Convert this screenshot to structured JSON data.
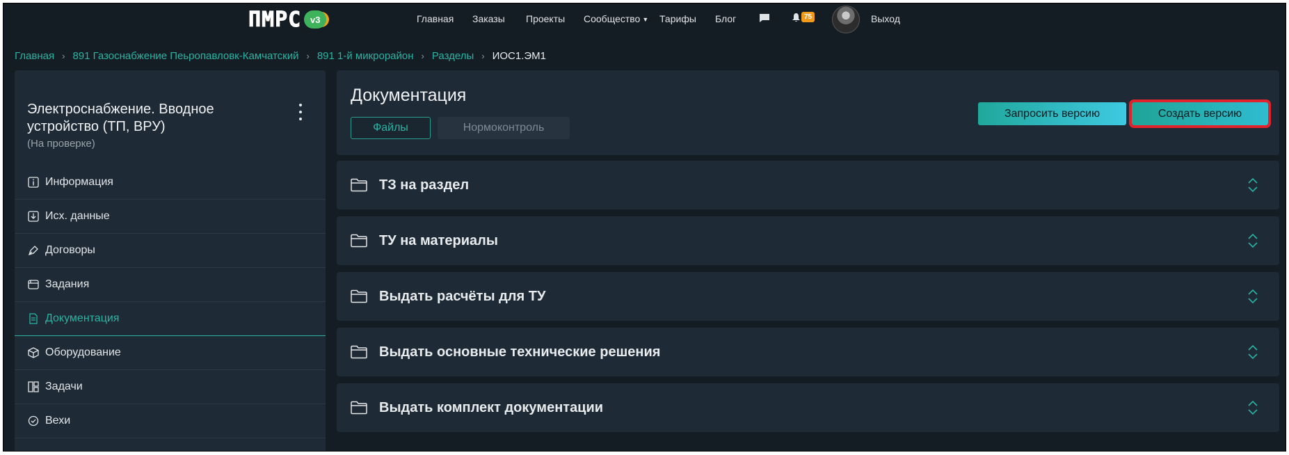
{
  "nav": {
    "logo_text": "ПМРС",
    "logo_badge": "v3",
    "items": [
      {
        "label": "Главная"
      },
      {
        "label": "Заказы"
      },
      {
        "label": "Проекты"
      },
      {
        "label": "Сообщество",
        "has_dropdown": true
      },
      {
        "label": "Тарифы"
      },
      {
        "label": "Блог"
      }
    ],
    "notifications_count": "75",
    "logout": "Выход",
    "icons": [
      "chat-icon",
      "bell-icon",
      "avatar"
    ]
  },
  "breadcrumb": [
    {
      "label": "Главная"
    },
    {
      "label": "891 Газоснабжение Пеьропавловк-Камчатский"
    },
    {
      "label": "891 1-й микрорайон"
    },
    {
      "label": "Разделы"
    },
    {
      "label": "ИОС1.ЭМ1",
      "current": true
    }
  ],
  "sidebar": {
    "title": "Электроснабжение. Вводное устройство (ТП, ВРУ)",
    "status": "(На проверке)",
    "items": [
      {
        "label": "Информация",
        "icon": "info-icon"
      },
      {
        "label": "Исх. данные",
        "icon": "download-icon"
      },
      {
        "label": "Договоры",
        "icon": "pen-icon"
      },
      {
        "label": "Задания",
        "icon": "window-icon"
      },
      {
        "label": "Документация",
        "icon": "document-icon",
        "active": true
      },
      {
        "label": "Оборудование",
        "icon": "box-icon"
      },
      {
        "label": "Задачи",
        "icon": "board-icon"
      },
      {
        "label": "Вехи",
        "icon": "check-circle-icon"
      }
    ]
  },
  "main": {
    "title": "Документация",
    "tabs": [
      {
        "label": "Файлы",
        "active": true
      },
      {
        "label": "Нормоконтроль",
        "active": false
      }
    ],
    "buttons": {
      "request_version": "Запросить версию",
      "create_version": "Создать версию"
    },
    "folders": [
      {
        "name": "ТЗ на раздел"
      },
      {
        "name": "ТУ на материалы"
      },
      {
        "name": "Выдать расчёты для ТУ"
      },
      {
        "name": "Выдать основные технические решения"
      },
      {
        "name": "Выдать комплект документации"
      }
    ]
  },
  "colors": {
    "accent": "#2bb3a3",
    "background": "#151d24",
    "panel": "#1e2a35",
    "badge": "#f39a1b",
    "highlight": "#e3232b"
  }
}
